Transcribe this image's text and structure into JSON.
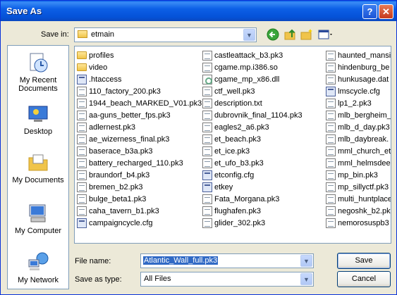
{
  "window": {
    "title": "Save As"
  },
  "titlebar": {
    "help": "?",
    "close": "✕"
  },
  "save_in": {
    "label": "Save in:",
    "value": "etmain"
  },
  "places": [
    {
      "label": "My Recent Documents",
      "icon": "recent-documents-icon"
    },
    {
      "label": "Desktop",
      "icon": "desktop-icon"
    },
    {
      "label": "My Documents",
      "icon": "my-documents-icon"
    },
    {
      "label": "My Computer",
      "icon": "my-computer-icon"
    },
    {
      "label": "My Network",
      "icon": "my-network-icon"
    }
  ],
  "files": {
    "col1": [
      {
        "name": "profiles",
        "type": "folder"
      },
      {
        "name": "video",
        "type": "folder"
      },
      {
        "name": ".htaccess",
        "type": "cfg"
      },
      {
        "name": "110_factory_200.pk3",
        "type": "doc"
      },
      {
        "name": "1944_beach_MARKED_V01.pk3",
        "type": "doc"
      },
      {
        "name": "aa-guns_better_fps.pk3",
        "type": "doc"
      },
      {
        "name": "adlernest.pk3",
        "type": "doc"
      },
      {
        "name": "ae_wizerness_final.pk3",
        "type": "doc"
      },
      {
        "name": "baserace_b3a.pk3",
        "type": "doc"
      },
      {
        "name": "battery_recharged_110.pk3",
        "type": "doc"
      },
      {
        "name": "braundorf_b4.pk3",
        "type": "doc"
      },
      {
        "name": "bremen_b2.pk3",
        "type": "doc"
      },
      {
        "name": "bulge_beta1.pk3",
        "type": "doc"
      },
      {
        "name": "caha_tavern_b1.pk3",
        "type": "doc"
      },
      {
        "name": "campaigncycle.cfg",
        "type": "cfg"
      }
    ],
    "col2": [
      {
        "name": "castleattack_b3.pk3",
        "type": "doc"
      },
      {
        "name": "cgame.mp.i386.so",
        "type": "doc"
      },
      {
        "name": "cgame_mp_x86.dll",
        "type": "dll"
      },
      {
        "name": "ctf_well.pk3",
        "type": "doc"
      },
      {
        "name": "description.txt",
        "type": "doc"
      },
      {
        "name": "dubrovnik_final_1104.pk3",
        "type": "doc"
      },
      {
        "name": "eagles2_a6.pk3",
        "type": "doc"
      },
      {
        "name": "et_beach.pk3",
        "type": "doc"
      },
      {
        "name": "et_ice.pk3",
        "type": "doc"
      },
      {
        "name": "et_ufo_b3.pk3",
        "type": "doc"
      },
      {
        "name": "etconfig.cfg",
        "type": "cfg"
      },
      {
        "name": "etkey",
        "type": "cfg"
      },
      {
        "name": "Fata_Morgana.pk3",
        "type": "doc"
      },
      {
        "name": "flughafen.pk3",
        "type": "doc"
      },
      {
        "name": "glider_302.pk3",
        "type": "doc"
      }
    ],
    "col3": [
      {
        "name": "haunted_mansi",
        "type": "doc"
      },
      {
        "name": "hindenburg_be",
        "type": "doc"
      },
      {
        "name": "hunkusage.dat",
        "type": "doc"
      },
      {
        "name": "lmscycle.cfg",
        "type": "cfg"
      },
      {
        "name": "lp1_2.pk3",
        "type": "doc"
      },
      {
        "name": "mlb_bergheim_",
        "type": "doc"
      },
      {
        "name": "mlb_d_day.pk3",
        "type": "doc"
      },
      {
        "name": "mlb_daybreak.",
        "type": "doc"
      },
      {
        "name": "mml_church_et",
        "type": "doc"
      },
      {
        "name": "mml_helmsdeep",
        "type": "doc"
      },
      {
        "name": "mp_bin.pk3",
        "type": "doc"
      },
      {
        "name": "mp_sillyctf.pk3",
        "type": "doc"
      },
      {
        "name": "multi_huntplace",
        "type": "doc"
      },
      {
        "name": "negoshk_b2.pk",
        "type": "doc"
      },
      {
        "name": "nemorosuspb3",
        "type": "doc"
      }
    ]
  },
  "file_name": {
    "label": "File name:",
    "value": "Atlantic_Wall_full.pk3"
  },
  "save_as_type": {
    "label": "Save as type:",
    "value": "All Files"
  },
  "buttons": {
    "save": "Save",
    "cancel": "Cancel"
  }
}
